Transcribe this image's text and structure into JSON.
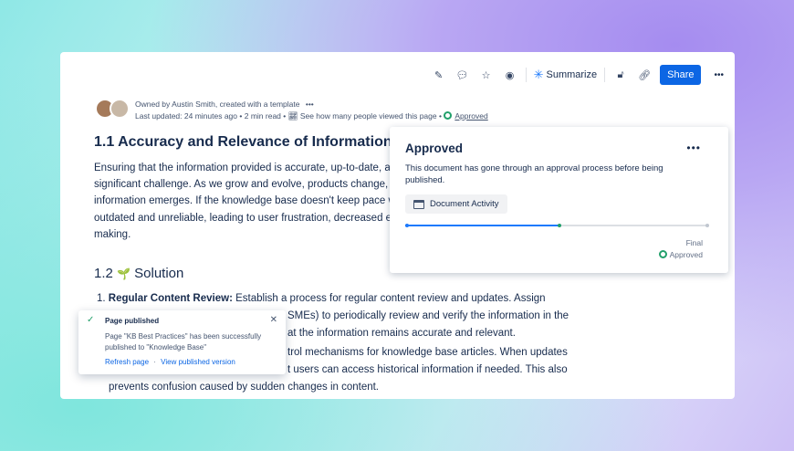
{
  "toolbar": {
    "summarize": "Summarize",
    "share": "Share",
    "more": "•••"
  },
  "meta": {
    "owner": "Owned by Austin Smith, created with a template",
    "owner_more": "•••",
    "updated": "Last updated: 24 minutes ago",
    "read": "2 min read",
    "views": "See how many people viewed this page",
    "status": "Approved",
    "dot": "•"
  },
  "doc": {
    "h1": "1.1 Accuracy and Relevance of Information",
    "para": [
      "Ensuring that the information provided is accurate, up-to-date, and",
      "significant challenge. As we grow and evolve, products change, proc",
      "information emerges. If the knowledge base doesn't keep pace with",
      "outdated and unreliable, leading to user frustration, decreased effici",
      "making."
    ],
    "h2_num": "1.2",
    "h2_icon": "🌱",
    "h2_text": "Solution",
    "list": {
      "num1": "1.",
      "bold1": "Regular Content Review:",
      "line1": " Establish a process for regular content review and updates. Assign",
      "line2": "SMEs) to periodically review and verify the information in the",
      "line3": "at the information remains accurate and relevant.",
      "line4": "trol mechanisms for knowledge base articles. When updates",
      "line5": "t users can access historical information if needed. This also",
      "line6": "prevents confusion caused by sudden changes in content."
    }
  },
  "popover": {
    "title": "Approved",
    "more": "•••",
    "desc": "This document has gone through an approval process before being published.",
    "activity": "Document Activity",
    "final": "Final",
    "status": "Approved",
    "progress": 0.5
  },
  "toast": {
    "title": "Page published",
    "message": "Page \"KB Best Practices\" has been successfully published to \"Knowledge Base\"",
    "refresh": "Refresh page",
    "sep": "·",
    "view": "View published version"
  }
}
